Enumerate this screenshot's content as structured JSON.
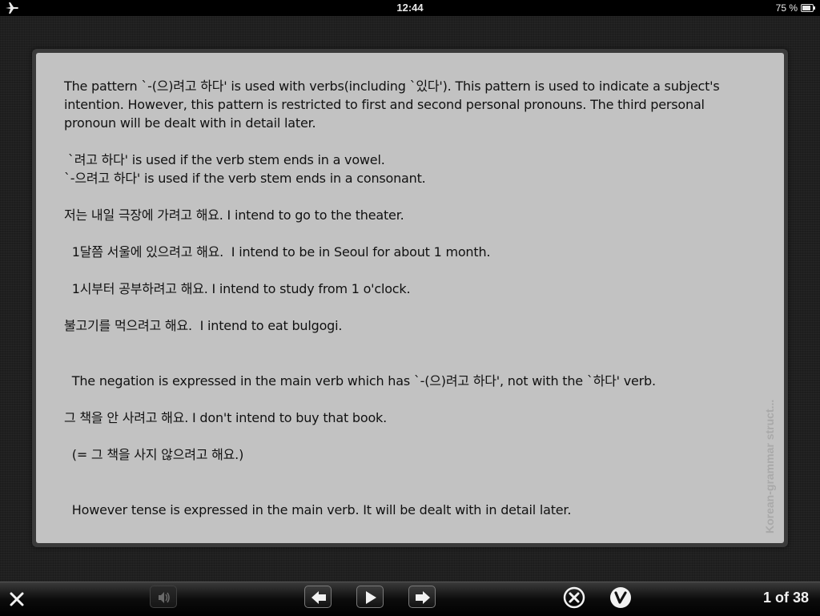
{
  "status_bar": {
    "time": "12:44",
    "battery": "75 %",
    "airplane_icon": "airplane-icon",
    "battery_icon": "battery-icon"
  },
  "card": {
    "side_label": "Korean-grammar struct...",
    "paragraphs": [
      "The pattern `-(으)려고 하다' is used with verbs(including `있다'). This pattern is used to indicate a subject's intention. However, this pattern is restricted to first and second personal pronouns. The third personal pronoun will be dealt with in detail later.",
      " `려고 하다' is used if the verb stem ends in a vowel.",
      "`-으려고 하다' is used if the verb stem ends in a consonant.",
      "저는 내일 극장에 가려고 해요. I intend to go to the theater.",
      "  1달쯤 서울에 있으려고 해요.  I intend to be in Seoul for about 1 month.",
      "  1시부터 공부하려고 해요. I intend to study from 1 o'clock.",
      "불고기를 먹으려고 해요.  I intend to eat bulgogi.",
      "  The negation is expressed in the main verb which has `-(으)려고 하다', not with the `하다' verb.",
      "그 책을 안 사려고 해요. I don't intend to buy that book.",
      "  (= 그 책을 사지 않으려고 해요.)",
      "  However tense is expressed in the main verb. It will be dealt with in detail later."
    ]
  },
  "toolbar": {
    "close_icon": "close-icon",
    "audio_icon": "speaker-icon",
    "prev_icon": "arrow-left-icon",
    "play_icon": "play-icon",
    "next_icon": "arrow-right-icon",
    "wrong_icon": "x-circle-icon",
    "correct_icon": "check-circle-icon",
    "page_counter": "1 of 38"
  }
}
